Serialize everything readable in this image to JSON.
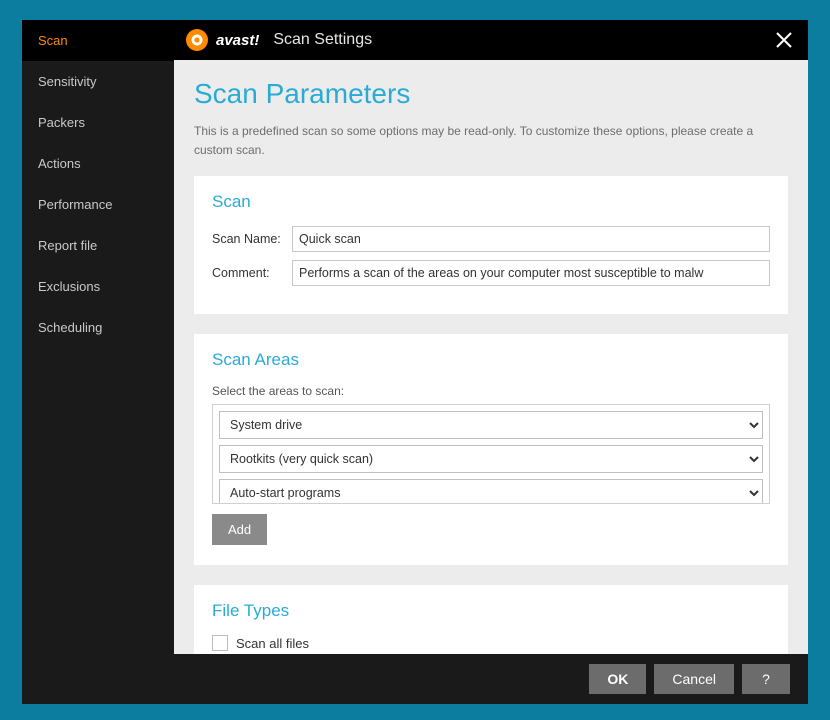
{
  "header": {
    "brand": "avast!",
    "title": "Scan Settings"
  },
  "sidebar": {
    "items": [
      {
        "label": "Scan",
        "active": true
      },
      {
        "label": "Sensitivity",
        "active": false
      },
      {
        "label": "Packers",
        "active": false
      },
      {
        "label": "Actions",
        "active": false
      },
      {
        "label": "Performance",
        "active": false
      },
      {
        "label": "Report file",
        "active": false
      },
      {
        "label": "Exclusions",
        "active": false
      },
      {
        "label": "Scheduling",
        "active": false
      }
    ]
  },
  "page": {
    "title": "Scan Parameters",
    "description": "This is a predefined scan so some options may be read-only. To customize these options, please create a custom scan."
  },
  "scan_section": {
    "title": "Scan",
    "name_label": "Scan Name:",
    "name_value": "Quick scan",
    "comment_label": "Comment:",
    "comment_value": "Performs a scan of the areas on your computer most susceptible to malw"
  },
  "areas_section": {
    "title": "Scan Areas",
    "subhead": "Select the areas to scan:",
    "items": [
      "System drive",
      "Rootkits (very quick scan)",
      "Auto-start programs"
    ],
    "add_label": "Add"
  },
  "filetypes_section": {
    "title": "File Types",
    "scan_all_label": "Scan all files",
    "scan_all_checked": false
  },
  "footer": {
    "ok": "OK",
    "cancel": "Cancel",
    "help": "?"
  }
}
